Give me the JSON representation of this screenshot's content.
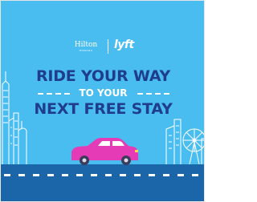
{
  "ad": {
    "partners": {
      "hilton_name": "Hilton",
      "hilton_sub": "HONORS",
      "lyft_name": "lyft"
    },
    "headline_line1": "RIDE YOUR WAY",
    "headline_line2": "TO YOUR",
    "headline_line3": "NEXT FREE STAY"
  },
  "colors": {
    "background": "#49bdf0",
    "headline": "#1f3d8c",
    "accent_white": "#ffffff",
    "car": "#e63bb6",
    "road": "#1b66a8"
  },
  "icons": [
    "car-icon",
    "city-skyline-icon",
    "ferris-wheel-icon",
    "road-icon"
  ]
}
